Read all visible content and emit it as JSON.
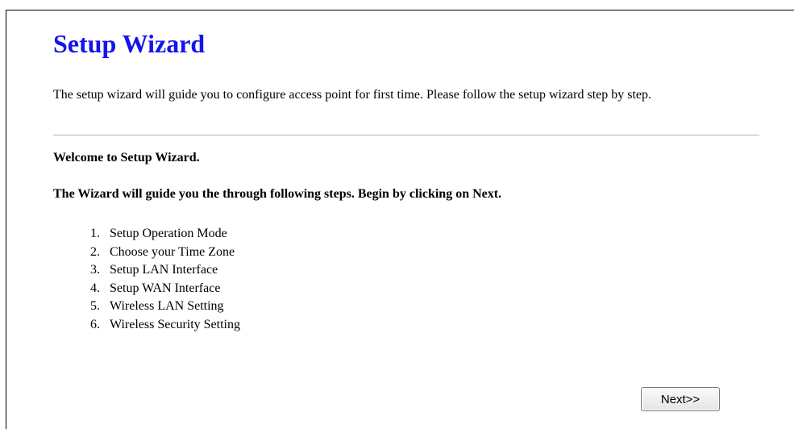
{
  "page": {
    "title": "Setup Wizard",
    "intro": "The setup wizard will guide you to configure access point for first time. Please follow the setup wizard step by step.",
    "welcome": "Welcome to Setup Wizard.",
    "guide": "The Wizard will guide you the through following steps. Begin by clicking on Next.",
    "title_color": "#1414ee"
  },
  "steps": [
    {
      "num": "1.",
      "label": "Setup Operation Mode"
    },
    {
      "num": "2.",
      "label": "Choose your Time Zone"
    },
    {
      "num": "3.",
      "label": "Setup LAN Interface"
    },
    {
      "num": "4.",
      "label": "Setup WAN Interface"
    },
    {
      "num": "5.",
      "label": "Wireless LAN Setting"
    },
    {
      "num": "6.",
      "label": "Wireless Security Setting"
    }
  ],
  "buttons": {
    "next_label": "Next>>"
  }
}
